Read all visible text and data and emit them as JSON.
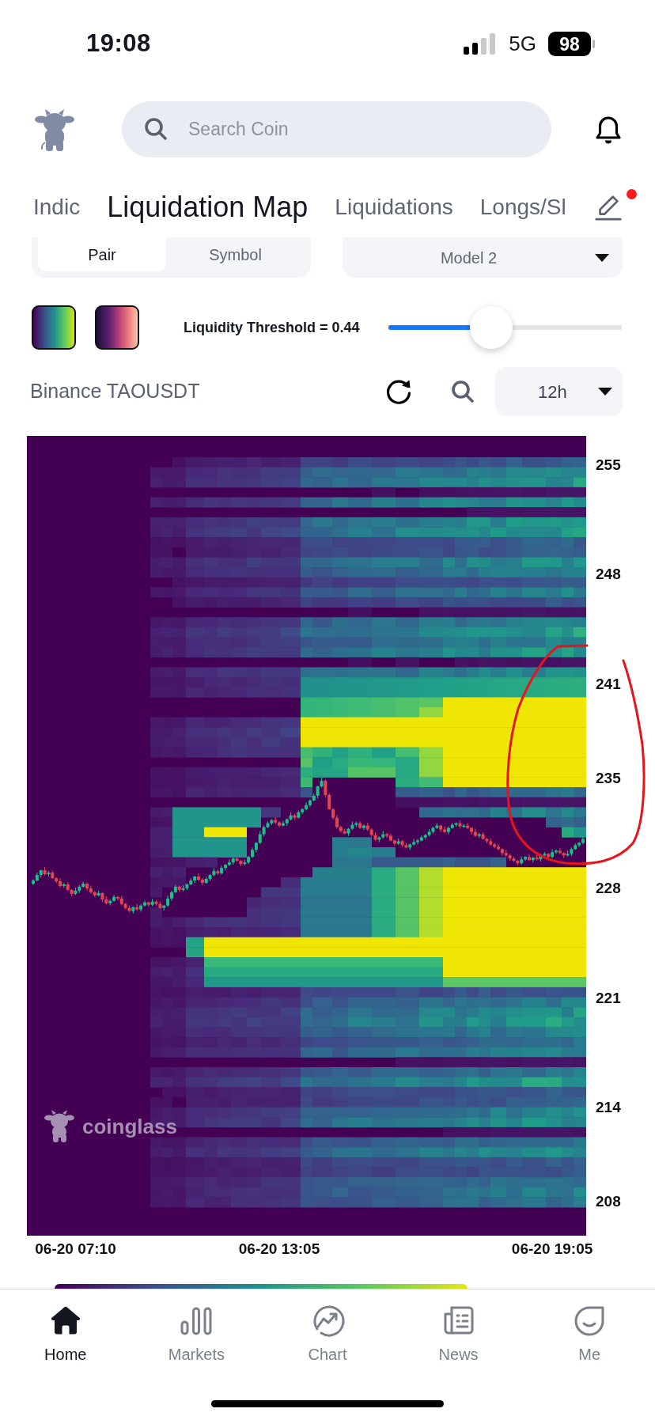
{
  "status_bar": {
    "time": "19:08",
    "network": "5G",
    "battery": "98"
  },
  "search": {
    "placeholder": "Search Coin"
  },
  "tabs": [
    {
      "label": "Indic",
      "selected": false
    },
    {
      "label": "Liquidation Map",
      "selected": true
    },
    {
      "label": "Liquidations",
      "selected": false
    },
    {
      "label": "Longs/Sl",
      "selected": false
    }
  ],
  "edit": {
    "badge": true
  },
  "mode_switch": [
    {
      "label": "Pair",
      "selected": true
    },
    {
      "label": "Symbol",
      "selected": false
    }
  ],
  "model_select": {
    "value": "Model 2"
  },
  "color_schemes": [
    {
      "kind": "viridis"
    },
    {
      "kind": "magma"
    }
  ],
  "threshold": {
    "label": "Liquidity Threshold = 0.44",
    "level": 0.44
  },
  "market": {
    "title": "Binance TAOUSDT",
    "interval": "12h"
  },
  "chart": {
    "chart_data": {
      "type": "candlestick",
      "categories": [
        null,
        null,
        null,
        null,
        null,
        null,
        null,
        null,
        null,
        null,
        null,
        "06-20 07:10",
        null,
        null,
        null,
        null,
        null,
        null,
        null,
        null,
        null,
        null,
        null,
        null,
        null,
        null,
        null,
        null,
        null,
        null,
        null,
        null,
        null,
        null,
        null,
        null,
        null,
        null,
        null,
        null,
        null,
        null,
        null,
        null,
        null,
        null,
        null,
        null,
        null,
        null,
        null,
        null,
        null,
        null,
        null,
        null,
        null,
        null,
        null,
        null,
        null,
        null,
        null,
        null,
        "06-20 13:05",
        null,
        null,
        null,
        null,
        null,
        null,
        null,
        null,
        null,
        null,
        null,
        null,
        null,
        null,
        null,
        null,
        null,
        null,
        null,
        null,
        null,
        null,
        null,
        null,
        null,
        null,
        null,
        null,
        null,
        null,
        null,
        null,
        null,
        null,
        null,
        null,
        null,
        null,
        null,
        null,
        null,
        null,
        null,
        null,
        null,
        null,
        null,
        null,
        null,
        null,
        null,
        null,
        null,
        null,
        null,
        null,
        null,
        null,
        null,
        null,
        null,
        null,
        null,
        null,
        null,
        null,
        null,
        null,
        null,
        null,
        "06-20 19:05",
        null,
        null,
        null,
        null,
        null,
        null,
        null,
        null
      ],
      "ohlc": [
        [
          228.25,
          228.53,
          228.15,
          228.45
        ],
        [
          228.45,
          228.95,
          228.39,
          228.8
        ],
        [
          228.8,
          229.15,
          228.64,
          229.1
        ],
        [
          229.1,
          229.3,
          228.77,
          228.85
        ],
        [
          228.85,
          229.05,
          228.71,
          228.95
        ],
        [
          228.95,
          229.07,
          228.55,
          228.6
        ],
        [
          228.6,
          228.66,
          228.28,
          228.4
        ],
        [
          228.4,
          228.58,
          228.01,
          228.1
        ],
        [
          228.1,
          228.28,
          228.0,
          228.2
        ],
        [
          228.2,
          228.35,
          227.79,
          227.85
        ],
        [
          227.85,
          227.9,
          227.44,
          227.6
        ],
        [
          227.6,
          228.0,
          227.52,
          227.8
        ],
        [
          227.8,
          228.15,
          227.66,
          228.05
        ],
        [
          228.05,
          228.37,
          228.0,
          228.25
        ],
        [
          228.25,
          228.31,
          227.83,
          227.95
        ],
        [
          227.95,
          228.13,
          227.61,
          227.7
        ],
        [
          227.7,
          227.78,
          227.4,
          227.5
        ],
        [
          227.5,
          227.8,
          227.44,
          227.65
        ],
        [
          227.65,
          227.7,
          227.09,
          227.25
        ],
        [
          227.25,
          227.45,
          226.92,
          227.0
        ],
        [
          227.0,
          227.25,
          226.86,
          227.15
        ],
        [
          227.15,
          227.52,
          227.1,
          227.4
        ],
        [
          227.4,
          227.46,
          227.18,
          227.3
        ],
        [
          227.3,
          227.48,
          226.86,
          226.95
        ],
        [
          226.95,
          227.03,
          226.6,
          226.7
        ],
        [
          226.7,
          226.85,
          226.44,
          226.5
        ],
        [
          226.5,
          226.8,
          226.34,
          226.75
        ],
        [
          226.75,
          226.95,
          226.52,
          226.6
        ],
        [
          226.6,
          226.95,
          226.46,
          226.85
        ],
        [
          226.85,
          227.17,
          226.8,
          227.05
        ],
        [
          227.05,
          227.11,
          226.78,
          226.9
        ],
        [
          226.9,
          227.28,
          226.81,
          227.1
        ],
        [
          227.1,
          227.18,
          226.85,
          226.95
        ],
        [
          226.95,
          227.1,
          226.64,
          226.7
        ],
        [
          226.7,
          226.9,
          226.54,
          226.85
        ],
        [
          226.85,
          227.5,
          226.77,
          227.3
        ],
        [
          227.3,
          227.8,
          227.16,
          227.7
        ],
        [
          227.7,
          228.17,
          227.65,
          228.05
        ],
        [
          228.05,
          228.11,
          227.73,
          227.85
        ],
        [
          227.85,
          228.13,
          227.76,
          227.95
        ],
        [
          227.95,
          228.28,
          227.85,
          228.2
        ],
        [
          228.2,
          228.6,
          228.14,
          228.45
        ],
        [
          228.45,
          228.75,
          228.29,
          228.7
        ],
        [
          228.7,
          228.9,
          228.42,
          228.5
        ],
        [
          228.5,
          228.6,
          228.16,
          228.3
        ],
        [
          228.3,
          228.67,
          228.25,
          228.55
        ],
        [
          228.55,
          228.86,
          228.43,
          228.8
        ],
        [
          228.8,
          229.23,
          228.71,
          229.05
        ],
        [
          229.05,
          229.13,
          228.8,
          228.9
        ],
        [
          228.9,
          229.4,
          228.84,
          229.25
        ],
        [
          229.25,
          229.5,
          229.09,
          229.45
        ],
        [
          229.45,
          229.8,
          229.37,
          229.6
        ],
        [
          229.6,
          229.95,
          229.46,
          229.85
        ],
        [
          229.85,
          229.97,
          229.65,
          229.7
        ],
        [
          229.7,
          229.76,
          229.38,
          229.5
        ],
        [
          229.5,
          229.78,
          229.41,
          229.6
        ],
        [
          229.6,
          230.03,
          229.5,
          229.95
        ],
        [
          229.95,
          230.55,
          229.89,
          230.4
        ],
        [
          230.4,
          230.9,
          230.24,
          230.85
        ],
        [
          230.85,
          231.6,
          230.77,
          231.4
        ],
        [
          231.4,
          231.95,
          231.26,
          231.85
        ],
        [
          231.85,
          232.22,
          231.8,
          232.1
        ],
        [
          232.1,
          232.36,
          231.98,
          232.3
        ],
        [
          232.3,
          232.48,
          232.06,
          232.15
        ],
        [
          232.15,
          232.23,
          231.85,
          231.95
        ],
        [
          231.95,
          232.25,
          231.89,
          232.1
        ],
        [
          232.1,
          232.4,
          231.94,
          232.35
        ],
        [
          232.35,
          232.8,
          232.27,
          232.6
        ],
        [
          232.6,
          232.7,
          232.31,
          232.45
        ],
        [
          232.45,
          232.92,
          232.4,
          232.8
        ],
        [
          232.8,
          233.06,
          232.68,
          233.0
        ],
        [
          233.0,
          233.43,
          232.91,
          233.25
        ],
        [
          233.25,
          233.63,
          233.15,
          233.55
        ],
        [
          233.55,
          234.0,
          233.49,
          233.85
        ],
        [
          233.85,
          234.5,
          233.69,
          234.45
        ],
        [
          234.45,
          235.0,
          234.37,
          234.8
        ],
        [
          234.8,
          234.9,
          233.76,
          233.9
        ],
        [
          233.9,
          234.02,
          232.95,
          233.0
        ],
        [
          233.0,
          233.06,
          232.33,
          232.45
        ],
        [
          232.45,
          232.63,
          231.76,
          231.85
        ],
        [
          231.85,
          231.93,
          231.5,
          231.6
        ],
        [
          231.6,
          231.75,
          231.39,
          231.45
        ],
        [
          231.45,
          231.8,
          231.29,
          231.75
        ],
        [
          231.75,
          232.2,
          231.67,
          232.0
        ],
        [
          232.0,
          232.2,
          231.86,
          232.1
        ],
        [
          232.1,
          232.22,
          231.75,
          231.8
        ],
        [
          231.8,
          232.01,
          231.68,
          231.95
        ],
        [
          231.95,
          232.13,
          231.61,
          231.7
        ],
        [
          231.7,
          231.78,
          231.25,
          231.35
        ],
        [
          231.35,
          231.5,
          230.99,
          231.05
        ],
        [
          231.05,
          231.25,
          230.89,
          231.2
        ],
        [
          231.2,
          231.6,
          231.12,
          231.4
        ],
        [
          231.4,
          231.5,
          231.16,
          231.3
        ],
        [
          231.3,
          231.42,
          230.95,
          231.0
        ],
        [
          231.0,
          231.06,
          230.68,
          230.8
        ],
        [
          230.8,
          231.13,
          230.71,
          230.95
        ],
        [
          230.95,
          231.03,
          230.6,
          230.7
        ],
        [
          230.7,
          230.85,
          230.49,
          230.55
        ],
        [
          230.55,
          230.8,
          230.39,
          230.75
        ],
        [
          230.75,
          231.1,
          230.67,
          230.9
        ],
        [
          230.9,
          231.1,
          230.76,
          231.0
        ],
        [
          231.0,
          231.32,
          230.95,
          231.2
        ],
        [
          231.2,
          231.41,
          231.08,
          231.35
        ],
        [
          231.35,
          231.73,
          231.26,
          231.55
        ],
        [
          231.55,
          231.88,
          231.45,
          231.8
        ],
        [
          231.8,
          232.1,
          231.74,
          231.95
        ],
        [
          231.95,
          232.0,
          231.54,
          231.7
        ],
        [
          231.7,
          231.9,
          231.47,
          231.55
        ],
        [
          231.55,
          231.9,
          231.41,
          231.8
        ],
        [
          231.8,
          232.12,
          231.75,
          232.0
        ],
        [
          232.0,
          232.16,
          231.88,
          232.1
        ],
        [
          232.1,
          232.28,
          231.81,
          231.9
        ],
        [
          231.9,
          232.03,
          231.8,
          231.95
        ],
        [
          231.95,
          232.1,
          231.74,
          231.8
        ],
        [
          231.8,
          231.85,
          231.39,
          231.55
        ],
        [
          231.55,
          231.75,
          231.22,
          231.3
        ],
        [
          231.3,
          231.5,
          231.16,
          231.4
        ],
        [
          231.4,
          231.52,
          231.05,
          231.1
        ],
        [
          231.1,
          231.16,
          230.83,
          230.95
        ],
        [
          230.95,
          231.13,
          230.66,
          230.75
        ],
        [
          230.75,
          230.83,
          230.5,
          230.6
        ],
        [
          230.6,
          230.75,
          230.39,
          230.45
        ],
        [
          230.45,
          230.5,
          230.04,
          230.2
        ],
        [
          230.2,
          230.4,
          229.97,
          230.05
        ],
        [
          230.05,
          230.15,
          229.71,
          229.85
        ],
        [
          229.85,
          229.97,
          229.65,
          229.7
        ],
        [
          229.7,
          229.76,
          229.43,
          229.55
        ],
        [
          229.55,
          229.98,
          229.46,
          229.8
        ],
        [
          229.8,
          230.03,
          229.7,
          229.95
        ],
        [
          229.95,
          230.1,
          229.69,
          229.75
        ],
        [
          229.75,
          229.95,
          229.59,
          229.9
        ],
        [
          229.9,
          230.1,
          229.72,
          229.8
        ],
        [
          229.8,
          230.15,
          229.66,
          230.05
        ],
        [
          230.05,
          230.27,
          230.0,
          230.15
        ],
        [
          230.15,
          230.21,
          229.83,
          229.95
        ],
        [
          229.95,
          230.43,
          229.86,
          230.25
        ],
        [
          230.25,
          230.43,
          230.15,
          230.35
        ],
        [
          230.35,
          230.5,
          230.14,
          230.2
        ],
        [
          230.2,
          230.25,
          229.89,
          230.05
        ],
        [
          230.05,
          230.35,
          229.97,
          230.15
        ],
        [
          230.15,
          230.55,
          230.01,
          230.45
        ],
        [
          230.45,
          230.82,
          230.4,
          230.7
        ],
        [
          230.7,
          230.91,
          230.58,
          230.85
        ],
        [
          230.85,
          231.28,
          230.76,
          231.1
        ]
      ],
      "ylim": [
        205.8,
        256.8
      ],
      "yticks": [
        255,
        248,
        241,
        235,
        228,
        221,
        214,
        208
      ]
    },
    "watermark": "coinglass",
    "markup": {
      "kind": "freehand-circle"
    }
  },
  "bottom_nav": [
    {
      "label": "Home",
      "selected": true
    },
    {
      "label": "Markets",
      "selected": false
    },
    {
      "label": "Chart",
      "selected": false
    },
    {
      "label": "News",
      "selected": false
    },
    {
      "label": "Me",
      "selected": false
    }
  ]
}
